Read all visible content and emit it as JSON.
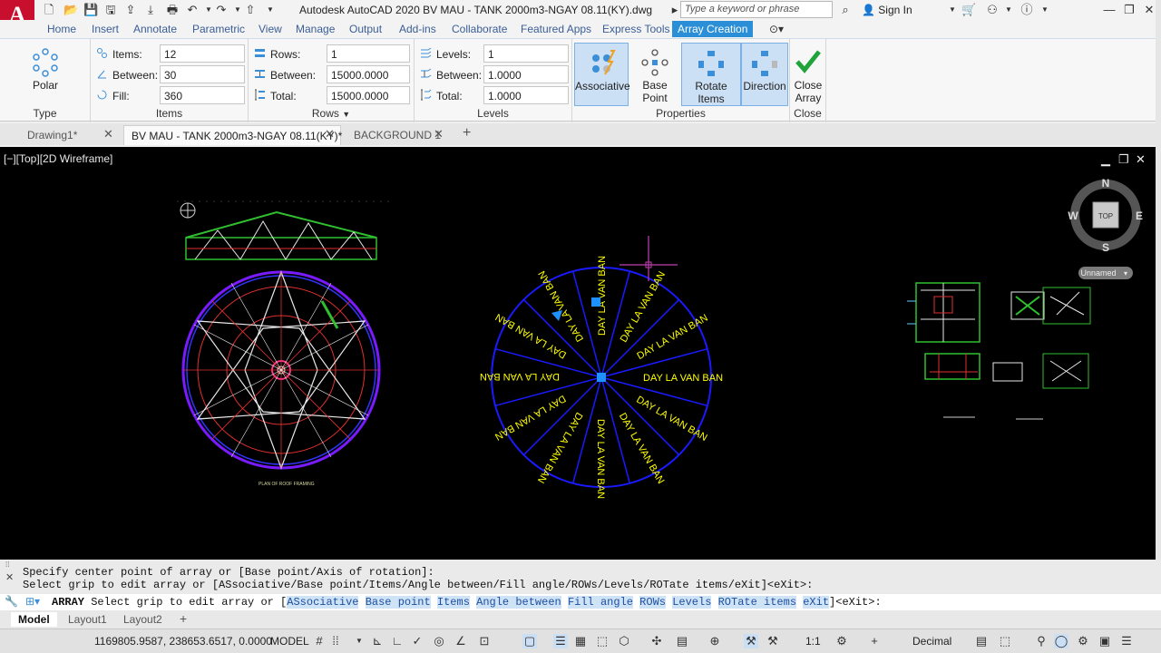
{
  "app": {
    "title": "Autodesk AutoCAD 2020   BV MAU - TANK 2000m3-NGAY 08.11(KY).dwg",
    "logo_letter": "A",
    "search_placeholder": "Type a keyword or phrase",
    "sign_in": "Sign In"
  },
  "menu_tabs": [
    "Home",
    "Insert",
    "Annotate",
    "Parametric",
    "View",
    "Manage",
    "Output",
    "Add-ins",
    "Collaborate",
    "Featured Apps",
    "Express Tools",
    "Array Creation"
  ],
  "ribbon": {
    "type_panel": {
      "button": "Polar",
      "title": "Type"
    },
    "items_panel": {
      "title": "Items",
      "items_label": "Items:",
      "items_value": "12",
      "between_label": "Between:",
      "between_value": "30",
      "fill_label": "Fill:",
      "fill_value": "360"
    },
    "rows_panel": {
      "title": "Rows",
      "rows_label": "Rows:",
      "rows_value": "1",
      "between_label": "Between:",
      "between_value": "15000.0000",
      "total_label": "Total:",
      "total_value": "15000.0000"
    },
    "levels_panel": {
      "title": "Levels",
      "levels_label": "Levels:",
      "levels_value": "1",
      "between_label": "Between:",
      "between_value": "1.0000",
      "total_label": "Total:",
      "total_value": "1.0000"
    },
    "properties_panel": {
      "title": "Properties",
      "associative": "Associative",
      "base_point": "Base Point",
      "rotate_items": "Rotate Items",
      "direction": "Direction"
    },
    "close_panel": {
      "title": "Close",
      "close_line1": "Close",
      "close_line2": "Array"
    }
  },
  "file_tabs": [
    "Drawing1*",
    "BV MAU - TANK 2000m3-NGAY 08.11(KY)*",
    "BACKGROUND 1"
  ],
  "viewport": {
    "label": "[−][Top][2D Wireframe]",
    "array_text": "DAY LA VAN BAN",
    "array_items": 12,
    "viewcube": {
      "top": "TOP",
      "n": "N",
      "s": "S",
      "e": "E",
      "w": "W",
      "ucs": "Unnamed"
    }
  },
  "command": {
    "history1": "Specify center point of array or [Base point/Axis of rotation]:",
    "history2": "Select grip to edit array or [ASsociative/Base point/Items/Angle between/Fill angle/ROWs/Levels/ROTate items/eXit]<eXit>:",
    "prompt_name": "ARRAY",
    "prompt_text": "Select grip to edit array or [",
    "options": [
      "ASsociative",
      "Base point",
      "Items",
      "Angle between",
      "Fill angle",
      "ROWs",
      "Levels",
      "ROTate items",
      "eXit"
    ],
    "prompt_end": "]<eXit>:"
  },
  "layout_tabs": [
    "Model",
    "Layout1",
    "Layout2"
  ],
  "status": {
    "coords": "1169805.9587, 238653.6517, 0.0000",
    "model": "MODEL",
    "scale": "1:1",
    "units": "Decimal"
  },
  "colors": {
    "accent": "#2a8fd6",
    "circle": "#1a1aff",
    "text": "#ffff00",
    "grip": "#1e90ff",
    "crosshair": "#c03fb0",
    "logo": "#c8102e"
  }
}
